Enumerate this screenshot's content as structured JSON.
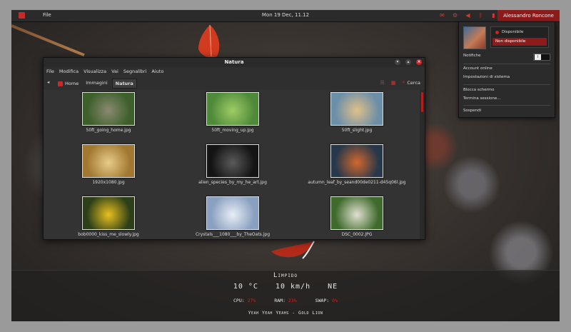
{
  "topbar": {
    "file_menu": "File",
    "clock": "Mon 19 Dec, 11.12",
    "user": "Alessandro Roncone",
    "tray_icons": [
      "mail-icon",
      "gear-icon",
      "volume-icon",
      "bluetooth-icon",
      "battery-icon",
      "network-icon"
    ]
  },
  "filemanager": {
    "title": "Natura",
    "menu": [
      "File",
      "Modifica",
      "Visualizza",
      "Vai",
      "Segnalibri",
      "Aiuto"
    ],
    "breadcrumbs": {
      "home": "Home",
      "images": "Immagini",
      "current": "Natura"
    },
    "search_label": "Cerca",
    "files": [
      {
        "name": "50ft_going_home.jpg",
        "colors": [
          "#3d5f2a",
          "#8a8a72"
        ]
      },
      {
        "name": "50ft_moving_up.jpg",
        "colors": [
          "#4f8a3a",
          "#9fcc66"
        ]
      },
      {
        "name": "50ft_slight.jpg",
        "colors": [
          "#6c8fa8",
          "#e0c08a"
        ]
      },
      {
        "name": "1920x1080.jpg",
        "colors": [
          "#a07830",
          "#e8cc8a"
        ]
      },
      {
        "name": "alien_species_by_my_he_art.jpg",
        "colors": [
          "#141414",
          "#5a5a5a"
        ]
      },
      {
        "name": "autumn_leaf_by_seand00de0211-d45q06l.jpg",
        "colors": [
          "#27384a",
          "#d2672d"
        ]
      },
      {
        "name": "bob0000_kiss_me_slowly.jpg",
        "colors": [
          "#2c3f18",
          "#e8c020"
        ]
      },
      {
        "name": "Crystals___1080___by_TheOats.jpg",
        "colors": [
          "#8aa0c0",
          "#e8eef6"
        ]
      },
      {
        "name": "DSC_0002.JPG",
        "colors": [
          "#3f6a2c",
          "#e0e0d0"
        ]
      }
    ]
  },
  "weather": {
    "condition": "Limpido",
    "temp": "10 °C",
    "wind": "10 km/h",
    "direction": "NE",
    "cpu_label": "CPU:",
    "cpu_value": "27%",
    "ram_label": "RAM:",
    "ram_value": "23%",
    "swap_label": "SWAP:",
    "swap_value": "0%",
    "now_playing": "Yeah Yeah Yeahs - Gold Lion"
  },
  "userpanel": {
    "status_available": "Disponibile",
    "status_unavailable": "Non disponibile",
    "notifications_label": "Notifiche",
    "toggle_state": "I",
    "items": [
      "Account online",
      "Impostazioni di sistema",
      "Blocca schermo",
      "Termina sessione...",
      "Sospendi"
    ]
  },
  "colors": {
    "accent": "#c62a2a",
    "panel": "#2b2b2b"
  }
}
